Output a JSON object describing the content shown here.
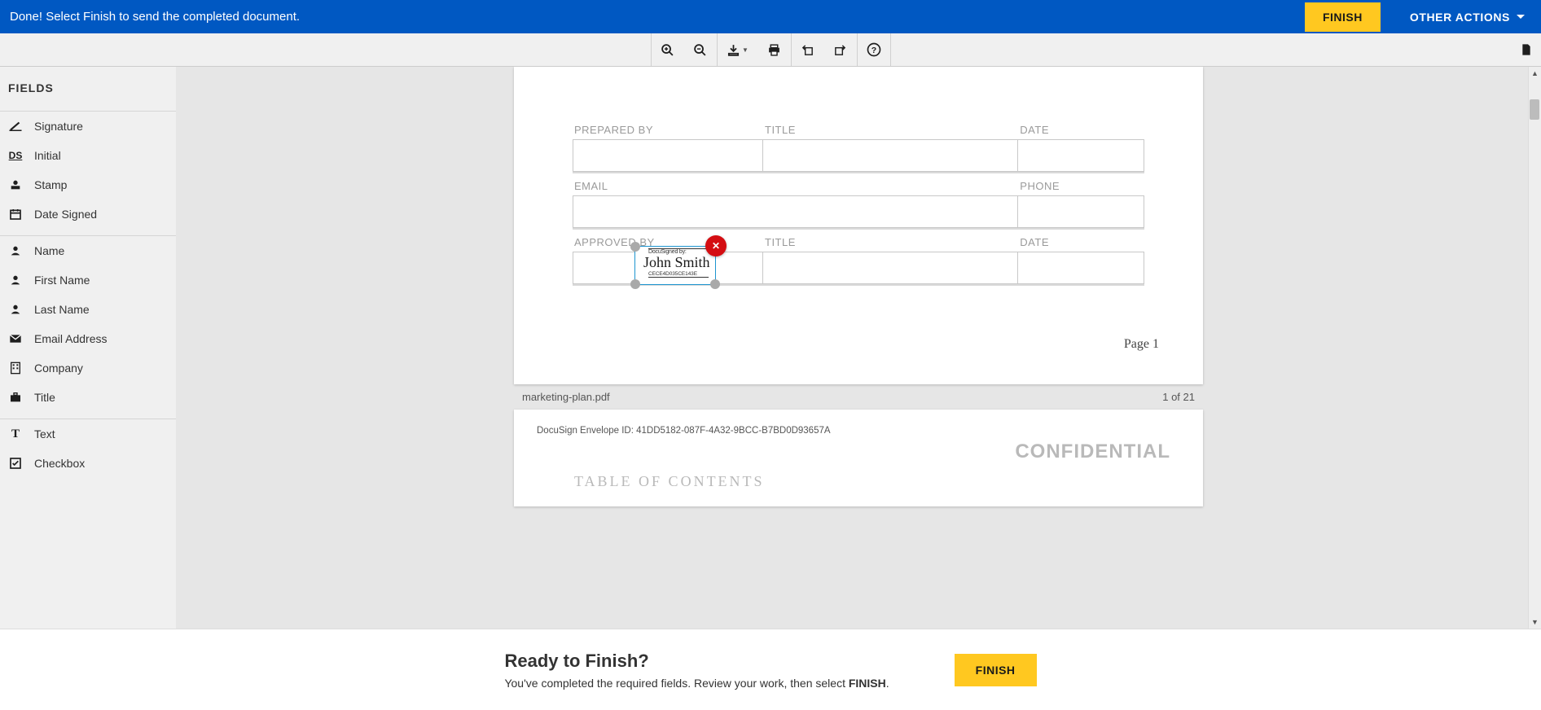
{
  "topbar": {
    "message": "Done! Select Finish to send the completed document.",
    "finish_label": "FINISH",
    "other_actions_label": "OTHER ACTIONS"
  },
  "toolbar": {
    "icons": {
      "zoom_in": "zoom-in-icon",
      "zoom_out": "zoom-out-icon",
      "download": "download-icon",
      "print": "print-icon",
      "rotate_left": "rotate-left-icon",
      "rotate_right": "rotate-right-icon",
      "help": "help-icon",
      "document": "document-icon"
    }
  },
  "sidebar": {
    "title": "FIELDS",
    "group_sig": [
      {
        "label": "Signature",
        "icon": "signature-icon"
      },
      {
        "label": "Initial",
        "icon": "initial-icon"
      },
      {
        "label": "Stamp",
        "icon": "stamp-icon"
      },
      {
        "label": "Date Signed",
        "icon": "calendar-icon"
      }
    ],
    "group_personal": [
      {
        "label": "Name",
        "icon": "person-icon"
      },
      {
        "label": "First Name",
        "icon": "person-icon"
      },
      {
        "label": "Last Name",
        "icon": "person-icon"
      },
      {
        "label": "Email Address",
        "icon": "mail-icon"
      },
      {
        "label": "Company",
        "icon": "building-icon"
      },
      {
        "label": "Title",
        "icon": "briefcase-icon"
      }
    ],
    "group_input": [
      {
        "label": "Text",
        "icon": "text-icon"
      },
      {
        "label": "Checkbox",
        "icon": "checkbox-icon"
      }
    ]
  },
  "document": {
    "form_row1": {
      "col1": "PREPARED BY",
      "col2": "TITLE",
      "col3": "DATE"
    },
    "form_row2": {
      "col1": "EMAIL",
      "col2": "PHONE"
    },
    "form_row3": {
      "col1": "APPROVED BY",
      "col2": "TITLE",
      "col3": "DATE"
    },
    "signature": {
      "top_caption": "DocuSigned by:",
      "name": "John Smith",
      "bottom_caption": "CECE4D035CE143E"
    },
    "page_number_label": "Page 1",
    "filename": "marketing-plan.pdf",
    "page_count": "1 of 21",
    "envelope_id": "DocuSign Envelope ID: 41DD5182-087F-4A32-9BCC-B7BD0D93657A",
    "confidential": "CONFIDENTIAL",
    "toc": "TABLE OF CONTENTS"
  },
  "footer": {
    "title": "Ready to Finish?",
    "subtitle_pre": "You've completed the required fields. Review your work, then select ",
    "subtitle_emph": "FINISH",
    "subtitle_post": ".",
    "finish_label": "FINISH"
  }
}
